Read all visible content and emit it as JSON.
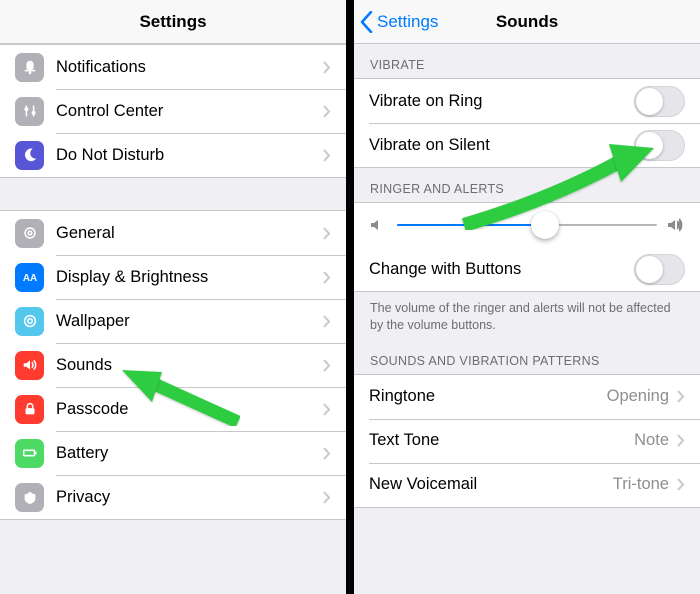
{
  "left": {
    "title": "Settings",
    "group1": [
      {
        "label": "Notifications",
        "icon": "notifications-icon",
        "icon_bg": "#b0b0b6"
      },
      {
        "label": "Control Center",
        "icon": "control-center-icon",
        "icon_bg": "#b0b0b6"
      },
      {
        "label": "Do Not Disturb",
        "icon": "dnd-icon",
        "icon_bg": "#5856d6"
      }
    ],
    "group2": [
      {
        "label": "General",
        "icon": "gear-icon",
        "icon_bg": "#b0b0b6"
      },
      {
        "label": "Display & Brightness",
        "icon": "display-icon",
        "icon_bg": "#007aff"
      },
      {
        "label": "Wallpaper",
        "icon": "wallpaper-icon",
        "icon_bg": "#54c7ec"
      },
      {
        "label": "Sounds",
        "icon": "sounds-icon",
        "icon_bg": "#ff3b30"
      },
      {
        "label": "Passcode",
        "icon": "lock-icon",
        "icon_bg": "#ff3b30"
      },
      {
        "label": "Battery",
        "icon": "battery-icon",
        "icon_bg": "#4cd964"
      },
      {
        "label": "Privacy",
        "icon": "privacy-icon",
        "icon_bg": "#b0b0b6"
      }
    ]
  },
  "right": {
    "back_label": "Settings",
    "title": "Sounds",
    "sections": {
      "vibrate": {
        "header": "VIBRATE",
        "rows": [
          {
            "label": "Vibrate on Ring",
            "on": false
          },
          {
            "label": "Vibrate on Silent",
            "on": false
          }
        ]
      },
      "ringer": {
        "header": "RINGER AND ALERTS",
        "volume_percent": 57,
        "change_buttons": {
          "label": "Change with Buttons",
          "on": false
        },
        "note": "The volume of the ringer and alerts will not be affected by the volume buttons."
      },
      "patterns": {
        "header": "SOUNDS AND VIBRATION PATTERNS",
        "rows": [
          {
            "label": "Ringtone",
            "value": "Opening"
          },
          {
            "label": "Text Tone",
            "value": "Note"
          },
          {
            "label": "New Voicemail",
            "value": "Tri-tone"
          }
        ]
      }
    }
  },
  "annotations": {
    "arrow_color": "#2ecc40"
  }
}
